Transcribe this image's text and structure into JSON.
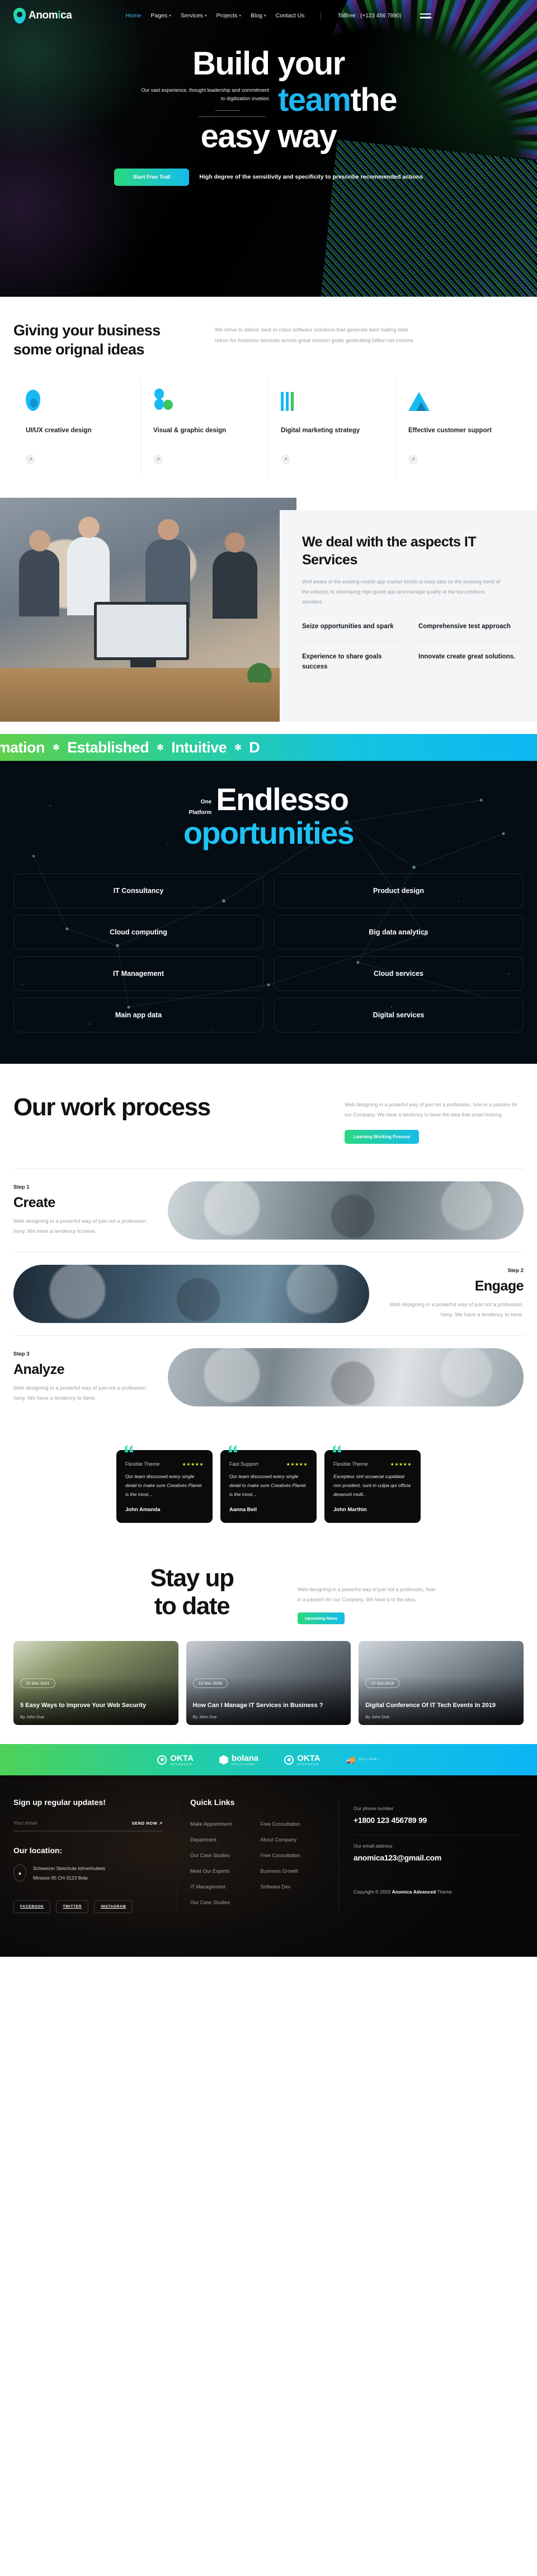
{
  "header": {
    "logo_text_a": "Anom",
    "logo_text_i": "i",
    "logo_text_b": "ca",
    "nav": [
      {
        "label": "Home",
        "caret": ""
      },
      {
        "label": "Pages",
        "caret": "▾"
      },
      {
        "label": "Services",
        "caret": "▾"
      },
      {
        "label": "Projects",
        "caret": "▾"
      },
      {
        "label": "Blog",
        "caret": "▾"
      },
      {
        "label": "Contact Us",
        "caret": ""
      }
    ],
    "tollfree": "Tollfree : (+123 456 7890)"
  },
  "hero": {
    "line1": "Build your",
    "accent": "team",
    "line2_tail": "the",
    "line3": "easy way",
    "note": "Our vast experience, thought leadership and commitment to digitization invetion",
    "cta_label": "Start Free Trall",
    "cta_note": "High degree of the sensitivity and specificity to prescribe recommended actions"
  },
  "ideas": {
    "title": "Giving your business some orignal ideas",
    "text": "We strive to deliver best in-class software solutions that generate best trailing total return for business services across great mission goals generating billion net income",
    "cards": [
      {
        "icon": "drop-icon",
        "name": "UI/UX creative design",
        "arrow": "↗"
      },
      {
        "icon": "bubbles-icon",
        "name": "Visual & graphic design",
        "arrow": "↗"
      },
      {
        "icon": "bars-icon",
        "name": "Digital marketing strategy",
        "arrow": "↗"
      },
      {
        "icon": "triangle-icon",
        "name": "Effective customer support",
        "arrow": "↗"
      }
    ]
  },
  "itservices": {
    "title": "We deal with the aspects IT Services",
    "desc": "Well aware of the existing mobile app market trends to keep tabs on the evolving trend of the industry, to developing high-grade app and manage quality at the top positions standard.",
    "items": [
      "Seize opportunities and spark",
      "Comprehensive test approach",
      "Experience to share goals success",
      "Innovate create great solutions."
    ]
  },
  "marquee": {
    "items": [
      "utomation",
      "Established",
      "Intuitive",
      "D"
    ],
    "star": "✻"
  },
  "endlesso": {
    "eyebrow_line1": "One",
    "eyebrow_line2": "Platform",
    "title": "Endlesso",
    "subtitle": "oportunities",
    "cells": [
      "IT Consultancy",
      "Product design",
      "Cloud computing",
      "Big data analytics",
      "IT Management",
      "Cloud services",
      "Main app data",
      "Digital services"
    ]
  },
  "work": {
    "title": "Our work process",
    "text": "Web designing in a powerful way of just not a profession, how in a passion for our Company. We have a tendency to beve the idea that smart looking.",
    "button": "Learning Working Process",
    "steps": [
      {
        "no": "Step 1",
        "title": "Create",
        "text": "Web designing in a powerful way of just not a profession, hony. We have a tendency to beve."
      },
      {
        "no": "Step 2",
        "title": "Engage",
        "text": "Web designing in a powerful way of just not a profession, hony. We have a tendency to beve."
      },
      {
        "no": "Step 3",
        "title": "Analyze",
        "text": "Web designing in a powerful way of just not a profession, hony. We have a tendency to beve."
      }
    ]
  },
  "testimonials": {
    "quote_glyph": "“",
    "stars": "★★★★★",
    "cards": [
      {
        "name": "Flexible Theme",
        "body": "Our team discussed every single detail to make sure Creatives Planet is the most...",
        "author": "John Amanda"
      },
      {
        "name": "Fast Support",
        "body": "Our team discussed every single detail to make sure Creatives Planet is the most...",
        "author": "Aanna Bell"
      },
      {
        "name": "Flexible Theme",
        "body": "Excepteur sint occaecat cupidatat non proident, sunt in culpa qui officia deserunt molli...",
        "author": "John Marthin"
      }
    ]
  },
  "blog": {
    "title_line1": "Stay up",
    "title_line2": "to date",
    "text": "Web designing in a powerful way of just not a profession, how in a passion for our Company. We have a to the idea.",
    "chip": "Upcoming News",
    "posts": [
      {
        "date": "22 Dec 2021",
        "title": "5 Easy Ways to Improve Your Web Security",
        "author": "By John Due"
      },
      {
        "date": "10 Nov 2020",
        "title": "How Can I Manage IT Services in Business ?",
        "author": "By John Due"
      },
      {
        "date": "17 Oct 2019",
        "title": "Digital Conference Of IT Tech Events In 2019",
        "author": "By John Due"
      }
    ]
  },
  "logobar": {
    "brands": [
      {
        "name": "OKTA",
        "sub": "ADVANCED",
        "icon": "circle-dot-icon"
      },
      {
        "name": "bolana",
        "sub": "SOLUTIONS",
        "icon": "hex-icon"
      },
      {
        "name": "OKTA",
        "sub": "ADVANCED",
        "icon": "circle-dot-icon"
      },
      {
        "name": "",
        "sub": "DELIVERY",
        "icon": "truck-icon"
      }
    ]
  },
  "footer": {
    "signup_title": "Sign up regular updates!",
    "email_placeholder": "Your email",
    "email_value": "",
    "send_label": "SEND NOW ↗",
    "location_title": "Our location:",
    "address_line1": "Schweizer Skischule lohnerhubels",
    "address_line2": "Mtrasse 95 CH-3123 Belp",
    "socials": [
      "FACEBOOK",
      "TWITTER",
      "INSTAGRAM"
    ],
    "quick_links_title": "Quick Links",
    "quick_links": [
      "Make Appointment",
      "Free Consultation",
      "Department",
      "About Company",
      "Our Case Studies",
      "Free Consultation",
      "Meet Our Experts",
      "Business Growth",
      "IT Management",
      "Software Dev",
      "Our Case Studies",
      ""
    ],
    "phone_label": "Our phone number",
    "phone_value": "+1800 123 456789 99",
    "email_label": "Our email address",
    "email_address": "anomica123@gmail.com",
    "copyright_pre": "Copyright © 2023 ",
    "copyright_brand": "Anomica Advanced",
    "copyright_post": " Theme"
  }
}
